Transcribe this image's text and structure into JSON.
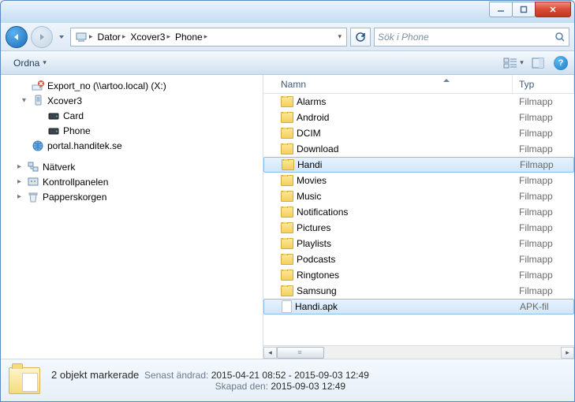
{
  "breadcrumb": {
    "root": "Dator",
    "device": "Xcover3",
    "folder": "Phone"
  },
  "search": {
    "placeholder": "Sök i Phone"
  },
  "toolbar": {
    "organize": "Ordna"
  },
  "tree": {
    "items": [
      {
        "label": "Export_no (\\\\artoo.local) (X:)",
        "icon": "drive-x",
        "indent": 0,
        "expander": ""
      },
      {
        "label": "Xcover3",
        "icon": "device",
        "indent": 0,
        "expander": "▾"
      },
      {
        "label": "Card",
        "icon": "storage",
        "indent": 1,
        "expander": ""
      },
      {
        "label": "Phone",
        "icon": "storage",
        "indent": 1,
        "expander": ""
      },
      {
        "label": "portal.handitek.se",
        "icon": "web",
        "indent": 0,
        "expander": ""
      }
    ],
    "bottom": [
      {
        "label": "Nätverk",
        "icon": "network"
      },
      {
        "label": "Kontrollpanelen",
        "icon": "control"
      },
      {
        "label": "Papperskorgen",
        "icon": "trash"
      }
    ]
  },
  "columns": {
    "name": "Namn",
    "type": "Typ"
  },
  "rows": [
    {
      "name": "Alarms",
      "type": "Filmapp",
      "icon": "folder",
      "selected": false
    },
    {
      "name": "Android",
      "type": "Filmapp",
      "icon": "folder",
      "selected": false
    },
    {
      "name": "DCIM",
      "type": "Filmapp",
      "icon": "folder",
      "selected": false
    },
    {
      "name": "Download",
      "type": "Filmapp",
      "icon": "folder",
      "selected": false
    },
    {
      "name": "Handi",
      "type": "Filmapp",
      "icon": "folder",
      "selected": true
    },
    {
      "name": "Movies",
      "type": "Filmapp",
      "icon": "folder",
      "selected": false
    },
    {
      "name": "Music",
      "type": "Filmapp",
      "icon": "folder",
      "selected": false
    },
    {
      "name": "Notifications",
      "type": "Filmapp",
      "icon": "folder",
      "selected": false
    },
    {
      "name": "Pictures",
      "type": "Filmapp",
      "icon": "folder",
      "selected": false
    },
    {
      "name": "Playlists",
      "type": "Filmapp",
      "icon": "folder",
      "selected": false
    },
    {
      "name": "Podcasts",
      "type": "Filmapp",
      "icon": "folder",
      "selected": false
    },
    {
      "name": "Ringtones",
      "type": "Filmapp",
      "icon": "folder",
      "selected": false
    },
    {
      "name": "Samsung",
      "type": "Filmapp",
      "icon": "folder",
      "selected": false
    },
    {
      "name": "Handi.apk",
      "type": "APK-fil",
      "icon": "file",
      "selected": true
    }
  ],
  "details": {
    "title": "2 objekt markerade",
    "modified_label": "Senast ändrad:",
    "modified_value": "2015-04-21 08:52 - 2015-09-03 12:49",
    "created_label": "Skapad den:",
    "created_value": "2015-09-03 12:49"
  }
}
